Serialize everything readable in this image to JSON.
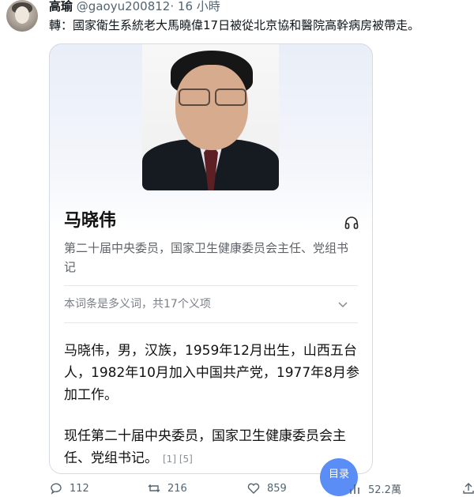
{
  "tweet": {
    "author_name": "高瑜",
    "handle": "@gaoyu200812",
    "separator": "·",
    "time": "16 小時",
    "text": "轉：國家衛生系統老大馬曉偉17日被從北京協和醫院高幹病房被帶走。"
  },
  "card": {
    "title": "马晓伟",
    "subtitle": "第二十届中央委员，国家卫生健康委员会主任、党组书记",
    "polysemy": "本词条是多义词，共17个义项",
    "paragraph1": "马晓伟，男，汉族，1959年12月出生，山西五台人，1982年10月加入中国共产党，1977年8月参加工作。",
    "paragraph2": "现任第二十届中央委员，国家卫生健康委员会主任、党组书记。",
    "refs": "[1] [5]",
    "fab_label": "目录"
  },
  "actions": {
    "replies": "112",
    "retweets": "216",
    "likes": "859",
    "views": "52.2萬"
  },
  "icons": [
    "headphones-icon",
    "chevron-down-icon",
    "reply-icon",
    "retweet-icon",
    "like-icon",
    "views-icon",
    "share-icon"
  ],
  "colors": {
    "accent": "#5b8df7",
    "muted": "#536471"
  }
}
